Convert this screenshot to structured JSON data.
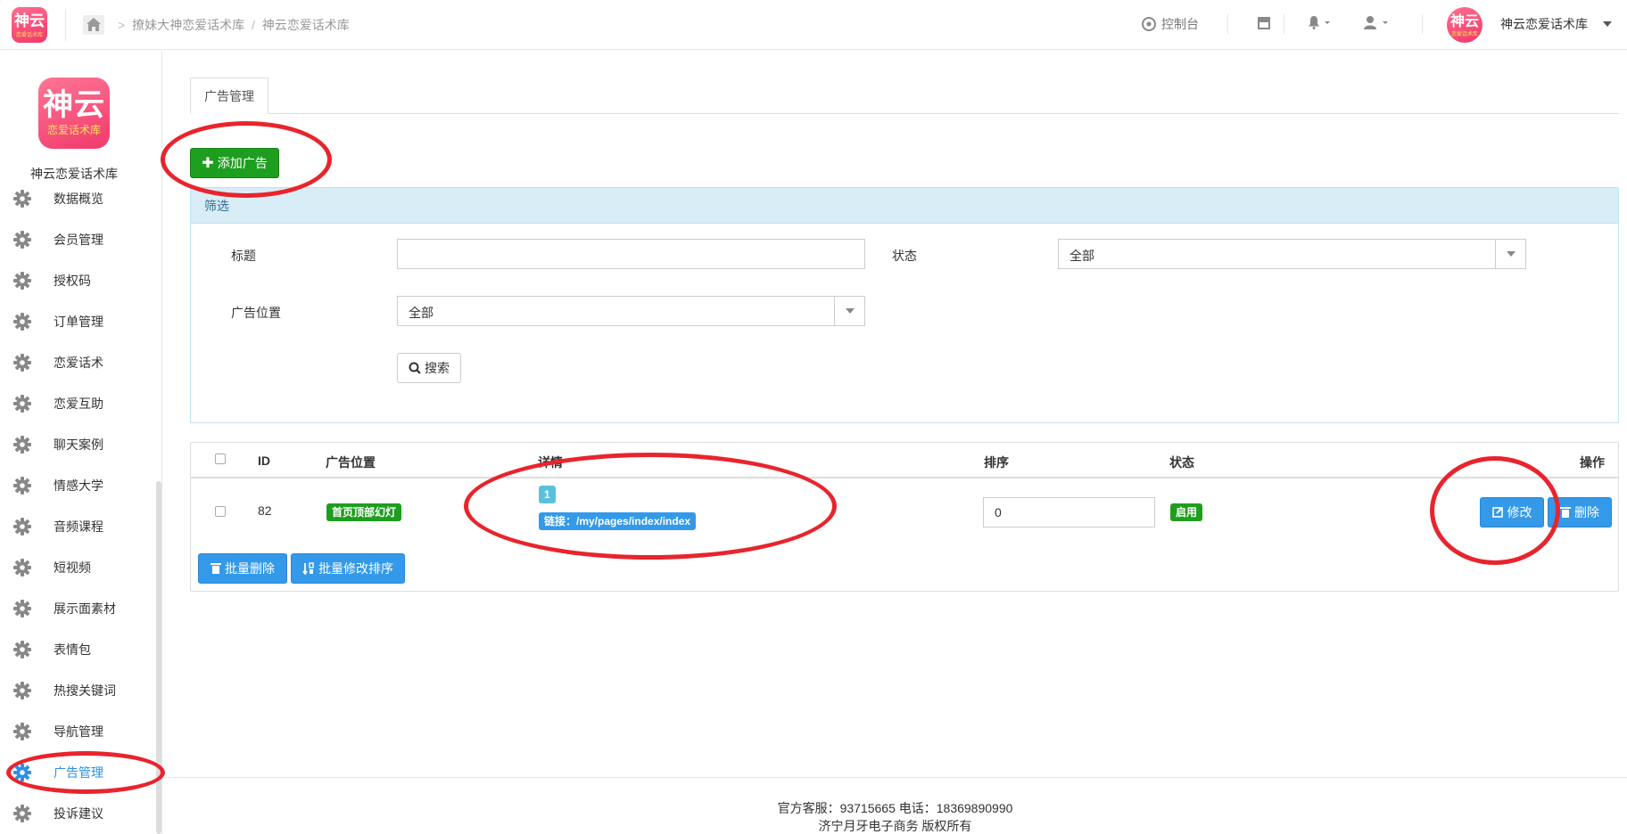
{
  "header": {
    "logo_big": "神云",
    "logo_small": "恋爱话术库",
    "breadcrumb": [
      "撩妹大神恋爱话术库",
      "神云恋爱话术库"
    ],
    "control_panel": "控制台",
    "user_name": "神云恋爱话术库"
  },
  "sidebar": {
    "logo_big": "神云",
    "logo_small": "恋爱话术库",
    "site_name": "神云恋爱话术库",
    "items": [
      {
        "label": "数据概览"
      },
      {
        "label": "会员管理"
      },
      {
        "label": "授权码"
      },
      {
        "label": "订单管理"
      },
      {
        "label": "恋爱话术"
      },
      {
        "label": "恋爱互助"
      },
      {
        "label": "聊天案例"
      },
      {
        "label": "情感大学"
      },
      {
        "label": "音频课程"
      },
      {
        "label": "短视频"
      },
      {
        "label": "展示面素材"
      },
      {
        "label": "表情包"
      },
      {
        "label": "热搜关键词"
      },
      {
        "label": "导航管理"
      },
      {
        "label": "广告管理",
        "active": true
      },
      {
        "label": "投诉建议"
      }
    ]
  },
  "main": {
    "tab": "广告管理",
    "add_button": "添加广告",
    "filter": {
      "heading": "筛选",
      "title_label": "标题",
      "title_value": "",
      "status_label": "状态",
      "status_value": "全部",
      "position_label": "广告位置",
      "position_value": "全部",
      "search_button": "搜索"
    },
    "table": {
      "columns": [
        "ID",
        "广告位置",
        "详情",
        "排序",
        "状态",
        "操作"
      ],
      "rows": [
        {
          "id": "82",
          "position": "首页顶部幻灯",
          "detail_index": "1",
          "detail_link": "链接：/my/pages/index/index",
          "sort": "0",
          "status": "启用",
          "edit": "修改",
          "delete": "删除"
        }
      ],
      "batch_delete": "批量删除",
      "batch_sort": "批量修改排序"
    }
  },
  "footer": {
    "line1": "官方客服：93715665 电话：18369890990",
    "line2": "济宁月牙电子商务 版权所有"
  },
  "colors": {
    "accent": "#3499e8",
    "success": "#1e9e1e",
    "annotation": "#e8242d"
  }
}
